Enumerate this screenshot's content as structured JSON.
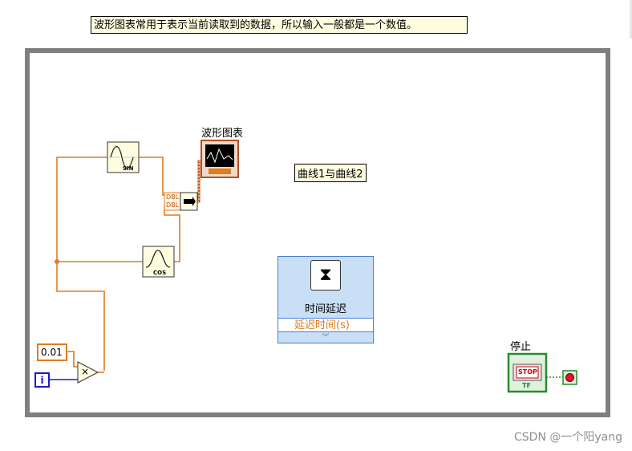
{
  "note": {
    "text": "波形图表常用于表示当前读取到的数据，所以输入一般都是一个数值。"
  },
  "blocks": {
    "chart_label": "波形图表",
    "sin_label": "SIN",
    "cos_label": "COS",
    "build_dbl_1": "DBL",
    "build_dbl_2": "DBL",
    "multiply_symbol": "×",
    "const_value": "0.01",
    "iteration_label": "i",
    "curve_label": "曲线1与曲线2",
    "time_delay": {
      "title": "时间延迟",
      "input": "延迟时间(s)"
    },
    "stop_label": "停止",
    "stop_text": "STOP",
    "stop_tf": "TF"
  },
  "colors": {
    "orange_wire": "#e07b1f",
    "blue_wire": "#1a1ad0",
    "green_wire": "#2a8a2a",
    "loop_border": "#7f7f7f"
  },
  "watermark": "CSDN @一个阳yang"
}
